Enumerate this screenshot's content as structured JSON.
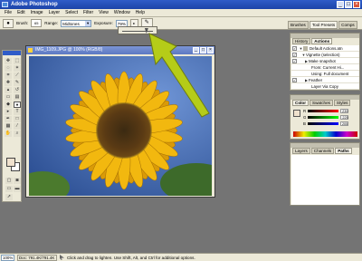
{
  "app": {
    "title": "Adobe Photoshop",
    "window_buttons": [
      "_",
      "□",
      "×"
    ]
  },
  "menu": [
    "File",
    "Edit",
    "Image",
    "Layer",
    "Select",
    "Filter",
    "View",
    "Window",
    "Help"
  ],
  "options_bar": {
    "brush_label": "Brush:",
    "brush_size": "65",
    "range_label": "Range:",
    "range_value": "Midtones",
    "exposure_label": "Exposure:",
    "exposure_value": "79%",
    "exposure_slider_pct": 79
  },
  "palette_well": [
    "Brushes",
    "Tool Presets",
    "Comps"
  ],
  "document": {
    "title": "IMG_1109.JPG @ 100% (RGB/8)"
  },
  "history_panel": {
    "tabs": [
      "History",
      "Actions"
    ],
    "active_tab": "Actions",
    "rows": [
      {
        "check": "✓",
        "tri": "▼",
        "label": "Default Actions.atn"
      },
      {
        "check": "✓",
        "tri": "▼",
        "label": "Vignette (selection)"
      },
      {
        "check": "✓",
        "tri": "▶",
        "label": "Make snapshot"
      },
      {
        "check": "",
        "tri": "",
        "label": "From: Current Hi..."
      },
      {
        "check": "",
        "tri": "",
        "label": "Using: Full document"
      },
      {
        "check": "✓",
        "tri": "▶",
        "label": "Feather"
      },
      {
        "check": "",
        "tri": "",
        "label": "Layer Via Copy"
      }
    ]
  },
  "color_panel": {
    "tabs": [
      "Color",
      "Swatches",
      "Styles"
    ],
    "active_tab": "Color",
    "channels": [
      {
        "name": "R",
        "value": "239"
      },
      {
        "name": "G",
        "value": "225"
      },
      {
        "name": "B",
        "value": "205"
      }
    ],
    "foreground": "#efe1cd"
  },
  "layers_panel": {
    "tabs": [
      "Layers",
      "Channels",
      "Paths"
    ],
    "active_tab": "Paths"
  },
  "status": {
    "zoom": "100%",
    "doc_size": "Doc: 791.4K/791.4K",
    "hint": "Click and drag to lighten. Use Shift, Alt, and Ctrl for additional options."
  },
  "colors": {
    "accent_arrow": "#b5cc18",
    "title_blue": "#2f5cc8",
    "workspace": "#747474"
  },
  "icons": {
    "tool_preset": "dodge-icon",
    "airbrush": "airbrush-icon"
  }
}
